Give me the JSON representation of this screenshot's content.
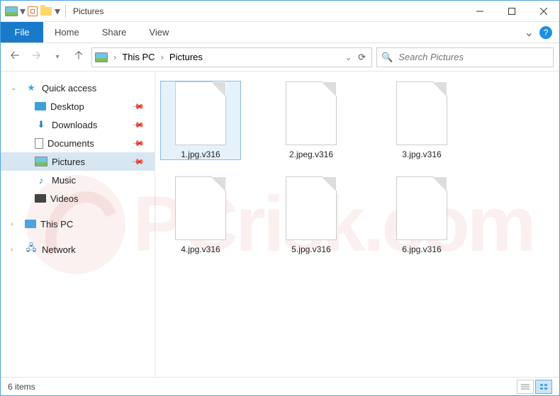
{
  "window": {
    "title": "Pictures"
  },
  "ribbon": {
    "file": "File",
    "tabs": [
      "Home",
      "Share",
      "View"
    ]
  },
  "breadcrumb": {
    "root": "This PC",
    "current": "Pictures"
  },
  "search": {
    "placeholder": "Search Pictures"
  },
  "sidebar": {
    "quick_access": "Quick access",
    "items": [
      {
        "label": "Desktop",
        "icon": "desktop",
        "pinned": true
      },
      {
        "label": "Downloads",
        "icon": "downloads",
        "pinned": true
      },
      {
        "label": "Documents",
        "icon": "documents",
        "pinned": true
      },
      {
        "label": "Pictures",
        "icon": "pictures",
        "pinned": true,
        "selected": true
      },
      {
        "label": "Music",
        "icon": "music",
        "pinned": false
      },
      {
        "label": "Videos",
        "icon": "videos",
        "pinned": false
      }
    ],
    "this_pc": "This PC",
    "network": "Network"
  },
  "files": [
    {
      "name": "1.jpg.v316",
      "selected": true
    },
    {
      "name": "2.jpeg.v316"
    },
    {
      "name": "3.jpg.v316"
    },
    {
      "name": "4.jpg.v316"
    },
    {
      "name": "5.jpg.v316"
    },
    {
      "name": "6.jpg.v316"
    }
  ],
  "status": {
    "count": "6 items"
  },
  "watermark": "PCrisk.com"
}
